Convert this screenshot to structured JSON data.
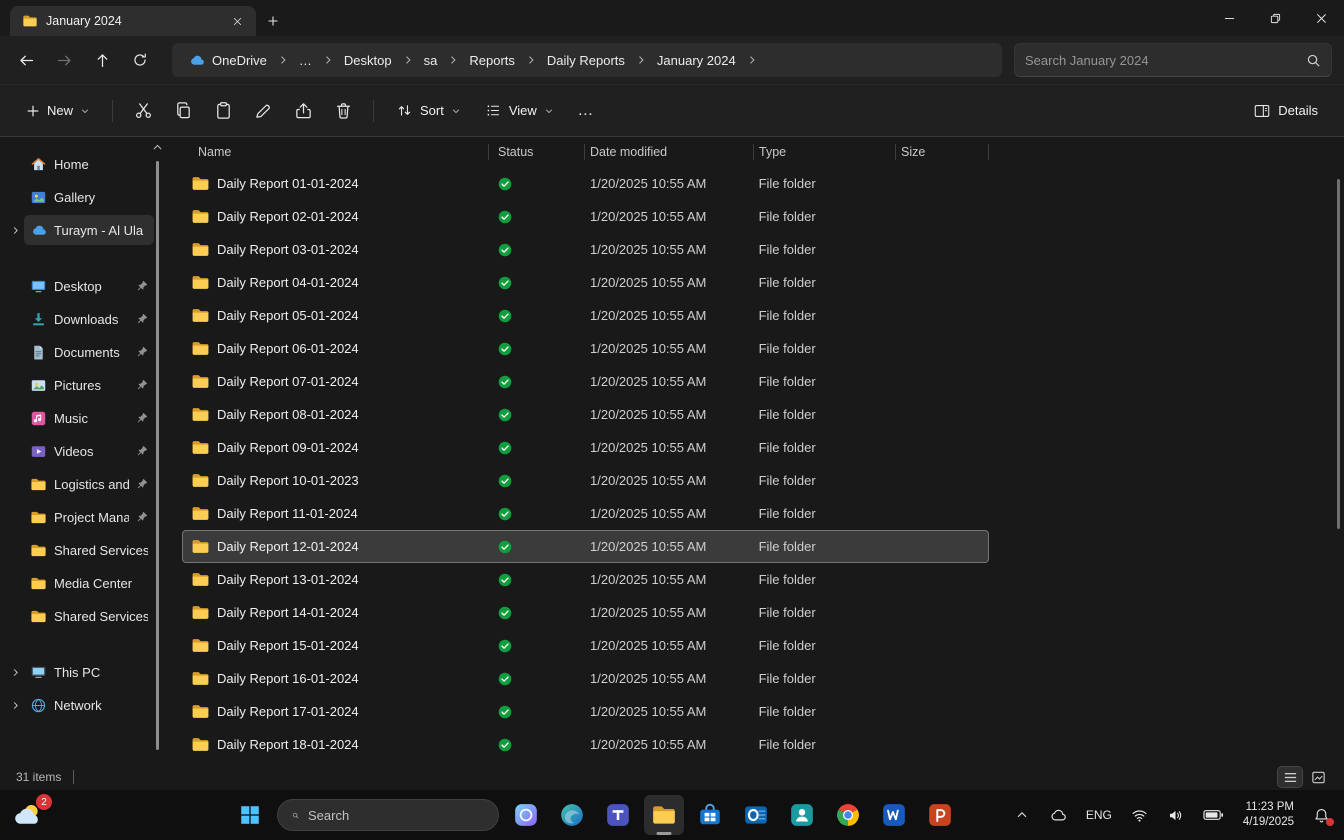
{
  "window": {
    "tab_title": "January 2024"
  },
  "nav": {
    "breadcrumb": [
      {
        "label": "OneDrive",
        "icon": "cloud"
      },
      {
        "label": "…"
      },
      {
        "label": "Desktop"
      },
      {
        "label": "sa"
      },
      {
        "label": "Reports"
      },
      {
        "label": "Daily Reports"
      },
      {
        "label": "January 2024"
      }
    ],
    "search_placeholder": "Search January 2024"
  },
  "toolbar": {
    "new_label": "New",
    "sort_label": "Sort",
    "view_label": "View",
    "more_glyph": "…",
    "details_label": "Details"
  },
  "sidebar": {
    "items": [
      {
        "label": "Home",
        "icon": "home"
      },
      {
        "label": "Gallery",
        "icon": "gallery"
      },
      {
        "label": "Turaym - Al Ula",
        "icon": "cloud",
        "expandable": true,
        "selected": true
      },
      {
        "divider": true
      },
      {
        "label": "Desktop",
        "icon": "desktop",
        "pinned": true
      },
      {
        "label": "Downloads",
        "icon": "downloads",
        "pinned": true
      },
      {
        "label": "Documents",
        "icon": "documents",
        "pinned": true
      },
      {
        "label": "Pictures",
        "icon": "pictures",
        "pinned": true
      },
      {
        "label": "Music",
        "icon": "music",
        "pinned": true
      },
      {
        "label": "Videos",
        "icon": "videos",
        "pinned": true
      },
      {
        "label": "Logistics and",
        "icon": "folder",
        "pinned": true
      },
      {
        "label": "Project Mana",
        "icon": "folder",
        "pinned": true
      },
      {
        "label": "Shared Services",
        "icon": "folder"
      },
      {
        "label": "Media Center",
        "icon": "folder"
      },
      {
        "label": "Shared Services",
        "icon": "folder"
      },
      {
        "divider": true
      },
      {
        "label": "This PC",
        "icon": "pc",
        "expandable": true
      },
      {
        "label": "Network",
        "icon": "network",
        "expandable": true
      }
    ]
  },
  "files": {
    "columns": {
      "name": "Name",
      "status": "Status",
      "date": "Date modified",
      "type": "Type",
      "size": "Size"
    },
    "rows": [
      {
        "name": "Daily Report 01-01-2024",
        "status": "synced",
        "date": "1/20/2025 10:55 AM",
        "type": "File folder",
        "size": ""
      },
      {
        "name": "Daily Report 02-01-2024",
        "status": "synced",
        "date": "1/20/2025 10:55 AM",
        "type": "File folder",
        "size": ""
      },
      {
        "name": "Daily Report 03-01-2024",
        "status": "synced",
        "date": "1/20/2025 10:55 AM",
        "type": "File folder",
        "size": ""
      },
      {
        "name": "Daily Report 04-01-2024",
        "status": "synced",
        "date": "1/20/2025 10:55 AM",
        "type": "File folder",
        "size": ""
      },
      {
        "name": "Daily Report 05-01-2024",
        "status": "synced",
        "date": "1/20/2025 10:55 AM",
        "type": "File folder",
        "size": ""
      },
      {
        "name": "Daily Report 06-01-2024",
        "status": "synced",
        "date": "1/20/2025 10:55 AM",
        "type": "File folder",
        "size": ""
      },
      {
        "name": "Daily Report 07-01-2024",
        "status": "synced",
        "date": "1/20/2025 10:55 AM",
        "type": "File folder",
        "size": ""
      },
      {
        "name": "Daily Report 08-01-2024",
        "status": "synced",
        "date": "1/20/2025 10:55 AM",
        "type": "File folder",
        "size": ""
      },
      {
        "name": "Daily Report 09-01-2024",
        "status": "synced",
        "date": "1/20/2025 10:55 AM",
        "type": "File folder",
        "size": ""
      },
      {
        "name": "Daily Report 10-01-2023",
        "status": "synced",
        "date": "1/20/2025 10:55 AM",
        "type": "File folder",
        "size": ""
      },
      {
        "name": "Daily Report 11-01-2024",
        "status": "synced",
        "date": "1/20/2025 10:55 AM",
        "type": "File folder",
        "size": ""
      },
      {
        "name": "Daily Report 12-01-2024",
        "status": "synced",
        "date": "1/20/2025 10:55 AM",
        "type": "File folder",
        "size": "",
        "selected": true
      },
      {
        "name": "Daily Report 13-01-2024",
        "status": "synced",
        "date": "1/20/2025 10:55 AM",
        "type": "File folder",
        "size": ""
      },
      {
        "name": "Daily Report 14-01-2024",
        "status": "synced",
        "date": "1/20/2025 10:55 AM",
        "type": "File folder",
        "size": ""
      },
      {
        "name": "Daily Report 15-01-2024",
        "status": "synced",
        "date": "1/20/2025 10:55 AM",
        "type": "File folder",
        "size": ""
      },
      {
        "name": "Daily Report 16-01-2024",
        "status": "synced",
        "date": "1/20/2025 10:55 AM",
        "type": "File folder",
        "size": ""
      },
      {
        "name": "Daily Report 17-01-2024",
        "status": "synced",
        "date": "1/20/2025 10:55 AM",
        "type": "File folder",
        "size": ""
      },
      {
        "name": "Daily Report 18-01-2024",
        "status": "synced",
        "date": "1/20/2025 10:55 AM",
        "type": "File folder",
        "size": ""
      }
    ]
  },
  "statusbar": {
    "items_count": "31 items"
  },
  "taskbar": {
    "search_placeholder": "Search",
    "widgets_badge": "2",
    "apps": [
      {
        "id": "copilot"
      },
      {
        "id": "edge"
      },
      {
        "id": "teams"
      },
      {
        "id": "file-explorer",
        "active": true
      },
      {
        "id": "store"
      },
      {
        "id": "outlook"
      },
      {
        "id": "teams-work"
      },
      {
        "id": "chrome"
      },
      {
        "id": "word"
      },
      {
        "id": "powerpoint"
      }
    ],
    "tray": {
      "language": "ENG",
      "time": "11:23 PM",
      "date": "4/19/2025"
    }
  }
}
